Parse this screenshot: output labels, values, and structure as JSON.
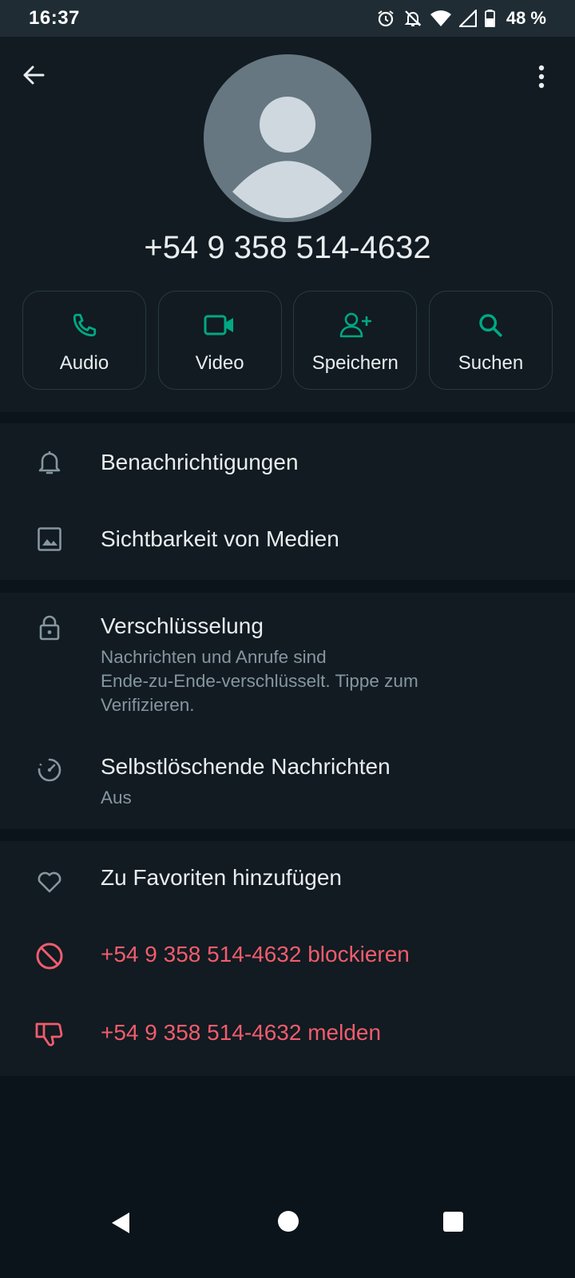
{
  "status_bar": {
    "time": "16:37",
    "battery": "48 %",
    "icons": [
      "alarm-icon",
      "silent-icon",
      "wifi-icon",
      "signal-icon",
      "battery-icon"
    ]
  },
  "header": {
    "phone": "+54 9 358 514-4632",
    "actions": [
      {
        "label": "Audio",
        "icon": "phone-icon"
      },
      {
        "label": "Video",
        "icon": "video-icon"
      },
      {
        "label": "Speichern",
        "icon": "add-person-icon"
      },
      {
        "label": "Suchen",
        "icon": "search-icon"
      }
    ]
  },
  "section1": {
    "notifications": "Benachrichtigungen",
    "media": "Sichtbarkeit von Medien"
  },
  "section2": {
    "encryption_title": "Verschlüsselung",
    "encryption_line1": "Nachrichten und Anrufe sind",
    "encryption_line2": "Ende-zu-Ende-verschlüsselt. Tippe zum",
    "encryption_line3": "Verifizieren.",
    "disappearing_title": "Selbstlöschende Nachrichten",
    "disappearing_value": "Aus"
  },
  "section3": {
    "favorites": "Zu Favoriten hinzufügen",
    "block": "+54 9 358 514-4632 blockieren",
    "report": "+54 9 358 514-4632 melden"
  },
  "colors": {
    "accent": "#00a884",
    "danger": "#f15c6d",
    "background": "#0b141a",
    "surface": "#111b21"
  }
}
